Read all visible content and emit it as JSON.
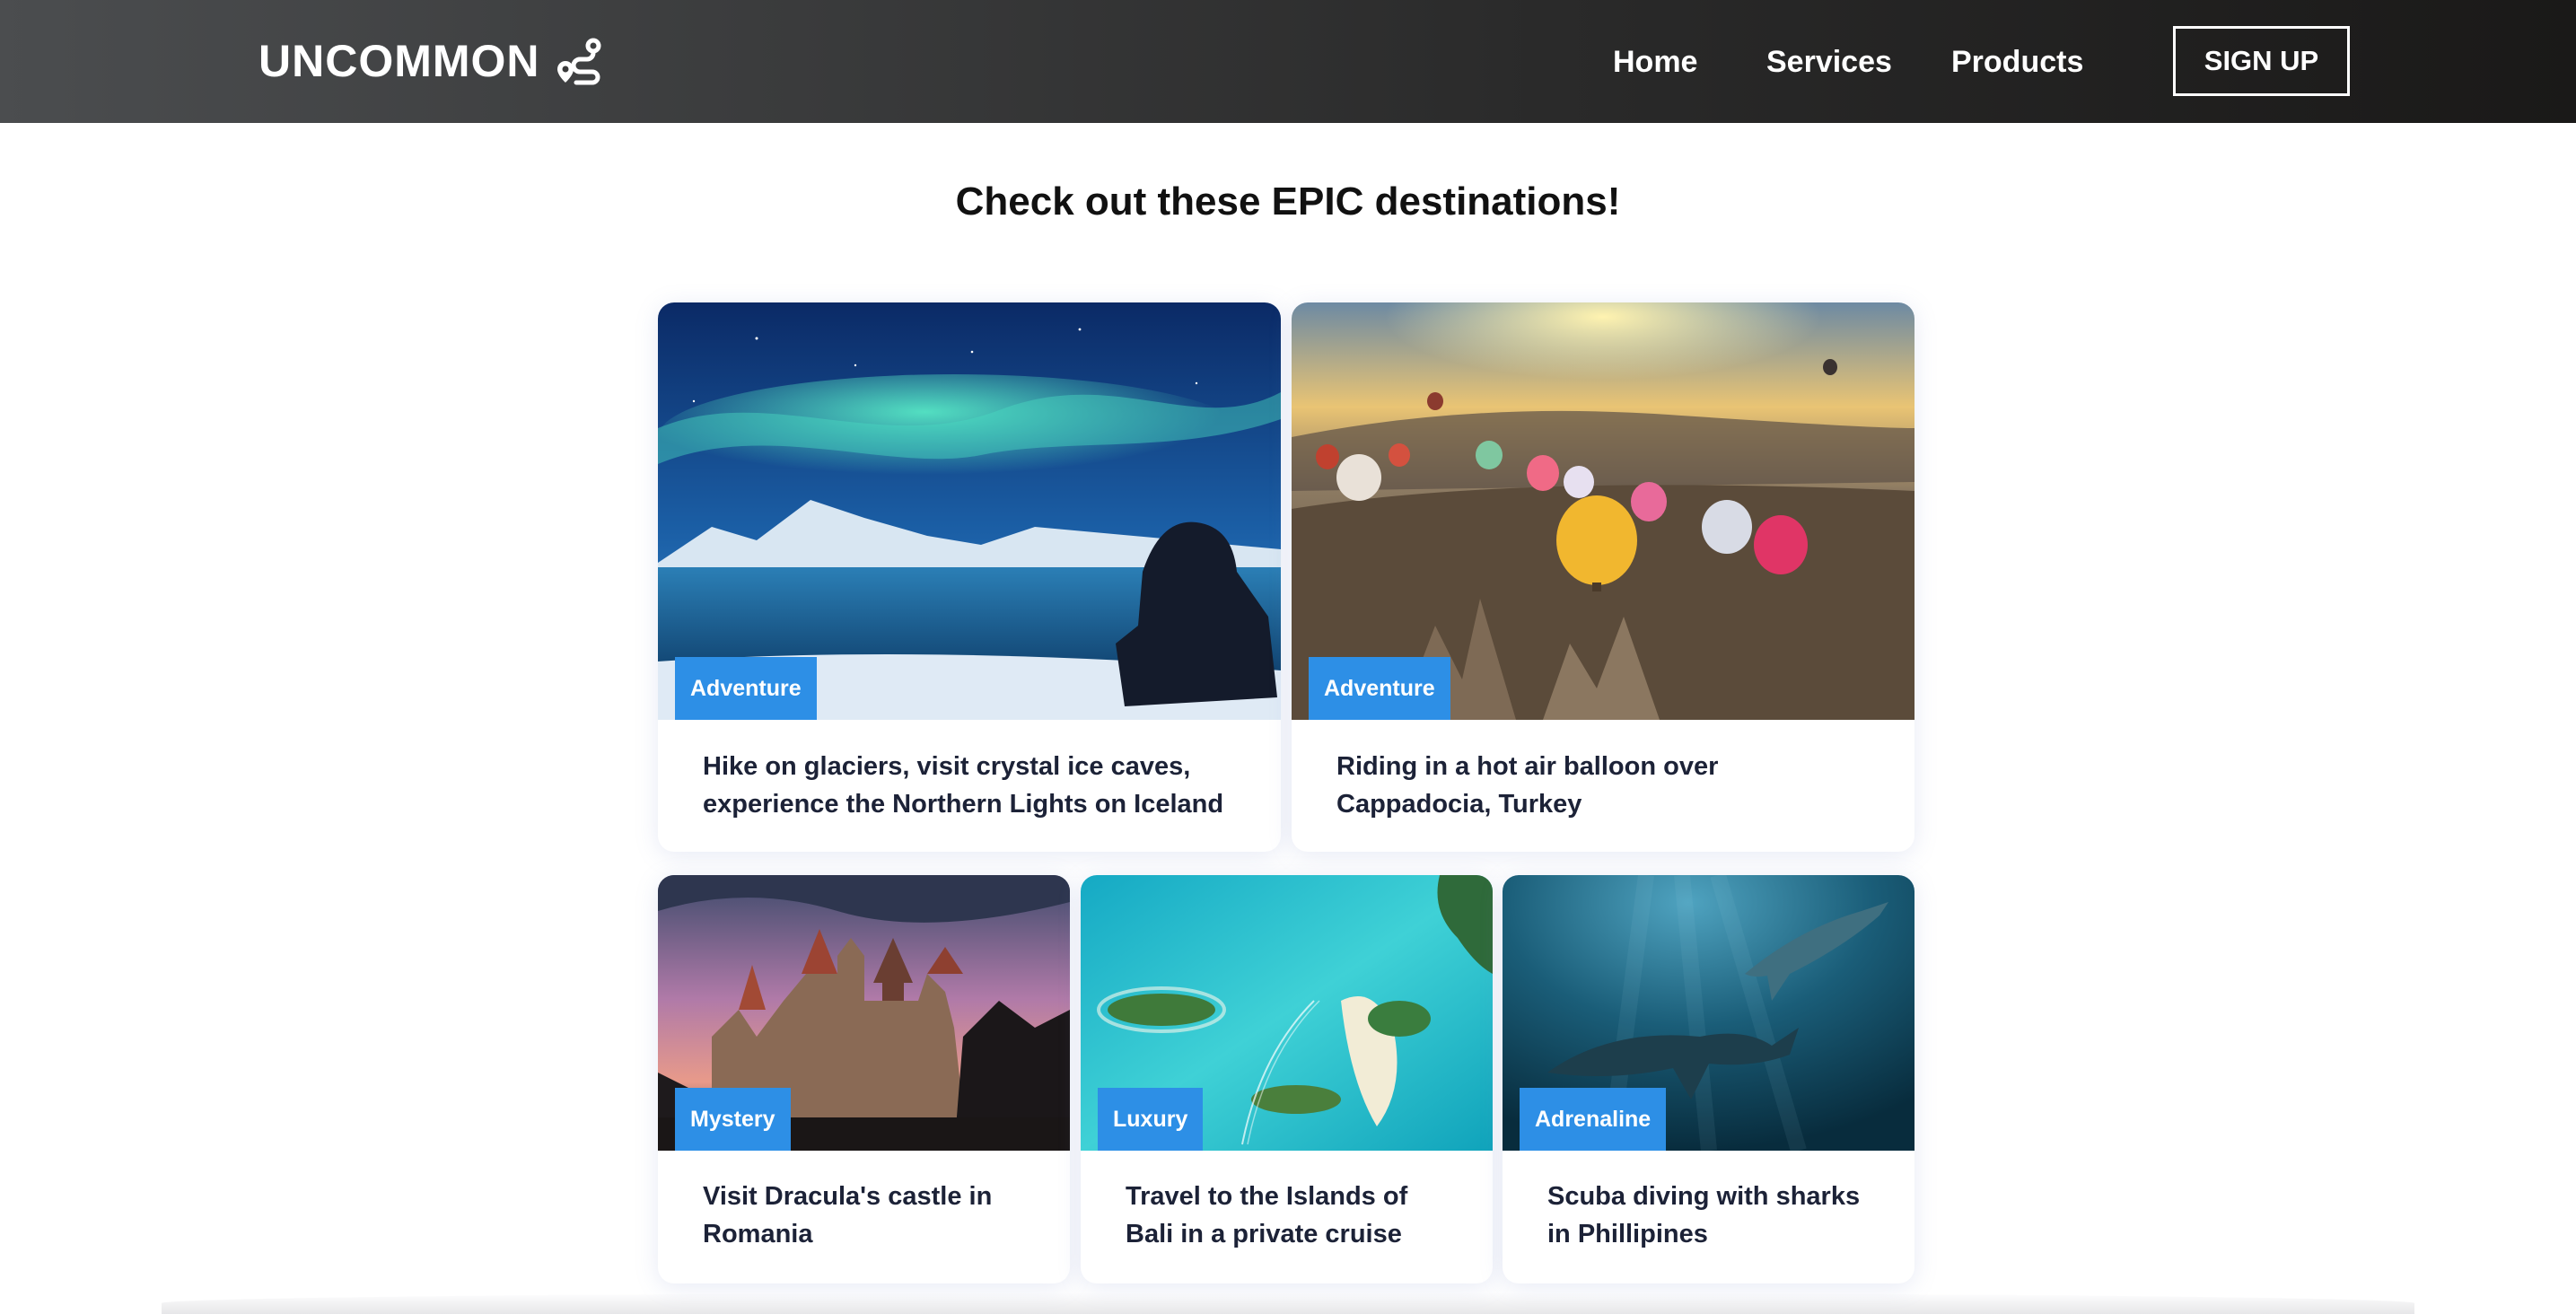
{
  "navbar": {
    "logo_text": "UNCOMMON",
    "logo_icon": "route-icon",
    "links": [
      "Home",
      "Services",
      "Products"
    ],
    "signup_label": "SIGN UP"
  },
  "main": {
    "heading": "Check out these EPIC destinations!",
    "cards": [
      {
        "tag": "Adventure",
        "text": "Hike on glaciers, visit crystal ice caves, experience the Northern Lights on Iceland",
        "image": "northern-lights-image"
      },
      {
        "tag": "Adventure",
        "text": "Riding in a hot air balloon over Cappadocia, Turkey",
        "image": "hot-air-balloons-image"
      },
      {
        "tag": "Mystery",
        "text": "Visit Dracula's castle in Romania",
        "image": "castle-image"
      },
      {
        "tag": "Luxury",
        "text": "Travel to the Islands of Bali in a private cruise",
        "image": "bali-islands-image"
      },
      {
        "tag": "Adrenaline",
        "text": "Scuba diving with sharks in Phillipines",
        "image": "sharks-image"
      }
    ]
  },
  "colors": {
    "navbar_start": "#4b4d4f",
    "navbar_end": "#1a1918",
    "tag_blue": "#2d8fe6",
    "card_text": "#1c2237"
  }
}
